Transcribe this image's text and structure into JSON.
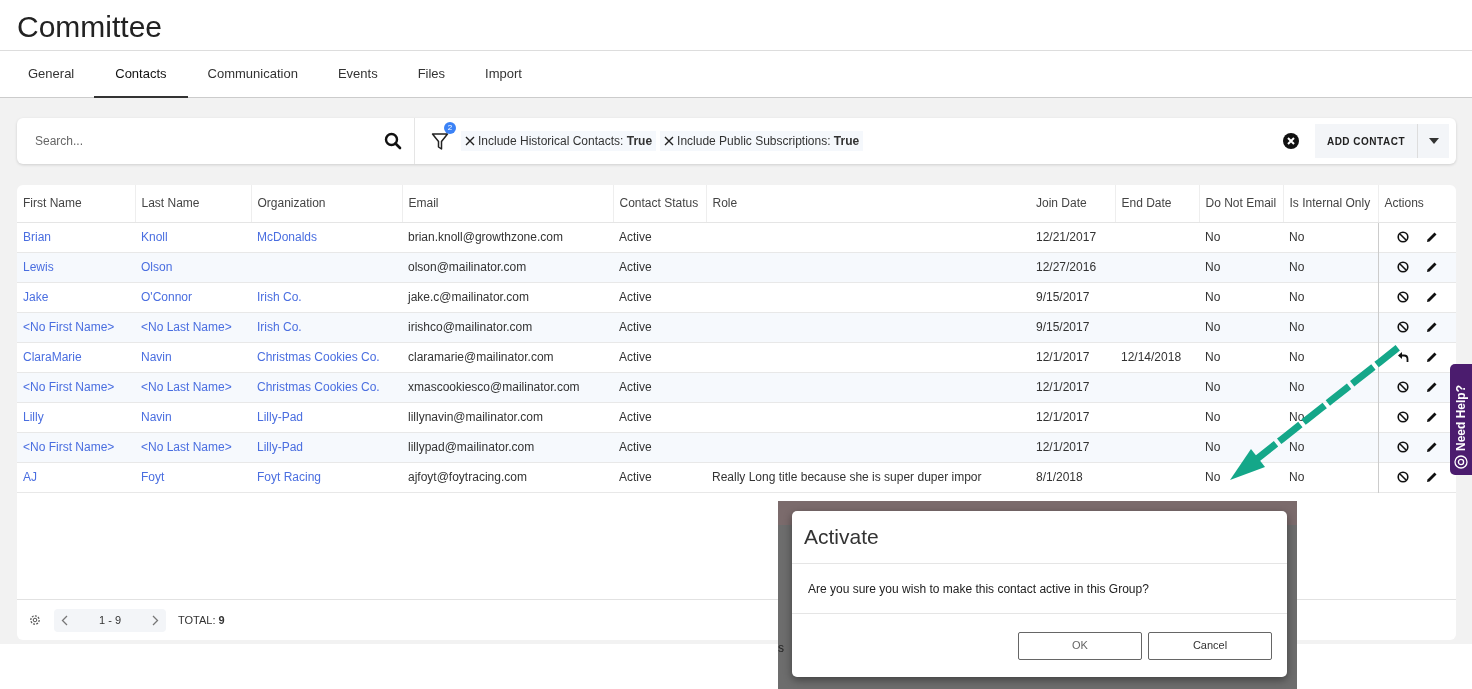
{
  "page_title": "Committee",
  "tabs": [
    {
      "label": "General",
      "selected": false
    },
    {
      "label": "Contacts",
      "selected": true
    },
    {
      "label": "Communication",
      "selected": false
    },
    {
      "label": "Events",
      "selected": false
    },
    {
      "label": "Files",
      "selected": false
    },
    {
      "label": "Import",
      "selected": false
    }
  ],
  "search": {
    "placeholder": "Search..."
  },
  "filter": {
    "badge": "2",
    "chips": [
      "Include Historical Contacts: **True**",
      "Include Public Subscriptions: **True**"
    ]
  },
  "add_button": "ADD CONTACT",
  "table": {
    "columns": [
      {
        "label": "First Name",
        "kind": "link"
      },
      {
        "label": "Last Name",
        "kind": "link"
      },
      {
        "label": "Organization",
        "kind": "link"
      },
      {
        "label": "Email",
        "kind": "text"
      },
      {
        "label": "Contact Status",
        "kind": "text"
      },
      {
        "label": "Role",
        "kind": "text"
      },
      {
        "label": "Join Date",
        "kind": "text"
      },
      {
        "label": "End Date",
        "kind": "text"
      },
      {
        "label": "Do Not Email",
        "kind": "text"
      },
      {
        "label": "Is Internal Only",
        "kind": "text"
      },
      {
        "label": "Actions",
        "kind": "actions"
      }
    ],
    "rows": [
      {
        "cells": [
          "Brian",
          "Knoll",
          "McDonalds",
          "brian.knoll@growthzone.com",
          "Active",
          null,
          "12/21/2017",
          null,
          "No",
          "No"
        ],
        "kind": "deactivate"
      },
      {
        "cells": [
          "Lewis",
          "Olson",
          null,
          "olson@mailinator.com",
          "Active",
          null,
          "12/27/2016",
          null,
          "No",
          "No"
        ],
        "kind": "deactivate"
      },
      {
        "cells": [
          "Jake",
          "O'Connor",
          "Irish Co.",
          "jake.c@mailinator.com",
          "Active",
          null,
          "9/15/2017",
          null,
          "No",
          "No"
        ],
        "kind": "deactivate"
      },
      {
        "cells": [
          "<No First Name>",
          "<No Last Name>",
          "Irish Co.",
          "irishco@mailinator.com",
          "Active",
          null,
          "9/15/2017",
          null,
          "No",
          "No"
        ],
        "kind": "deactivate"
      },
      {
        "cells": [
          "ClaraMarie",
          "Navin",
          "Christmas Cookies Co.",
          "claramarie@mailinator.com",
          "Active",
          null,
          "12/1/2017",
          "12/14/2018",
          "No",
          "No"
        ],
        "kind": "activate"
      },
      {
        "cells": [
          "<No First Name>",
          "<No Last Name>",
          "Christmas Cookies Co.",
          "xmascookiesco@mailinator.com",
          "Active",
          null,
          "12/1/2017",
          null,
          "No",
          "No"
        ],
        "kind": "deactivate"
      },
      {
        "cells": [
          "Lilly",
          "Navin",
          "Lilly-Pad",
          "lillynavin@mailinator.com",
          "Active",
          null,
          "12/1/2017",
          null,
          "No",
          "No"
        ],
        "kind": "deactivate"
      },
      {
        "cells": [
          "<No First Name>",
          "<No Last Name>",
          "Lilly-Pad",
          "lillypad@mailinator.com",
          "Active",
          null,
          "12/1/2017",
          null,
          "No",
          "No"
        ],
        "kind": "deactivate"
      },
      {
        "cells": [
          "AJ",
          "Foyt",
          "Foyt Racing",
          "ajfoyt@foytracing.com",
          "Active",
          "Really Long title because she is super duper impor",
          "8/1/2018",
          null,
          "No",
          "No"
        ],
        "kind": "deactivate"
      }
    ]
  },
  "pagination": {
    "range": "1 - 9",
    "total": "TOTAL: **9**"
  },
  "help_tab": "Need Help?",
  "inset": {
    "fragment": "s",
    "dialog": {
      "title": "Activate",
      "message": "Are you sure you wish to make this contact active in this Group?",
      "buttons": [
        "OK",
        "Cancel"
      ]
    }
  }
}
